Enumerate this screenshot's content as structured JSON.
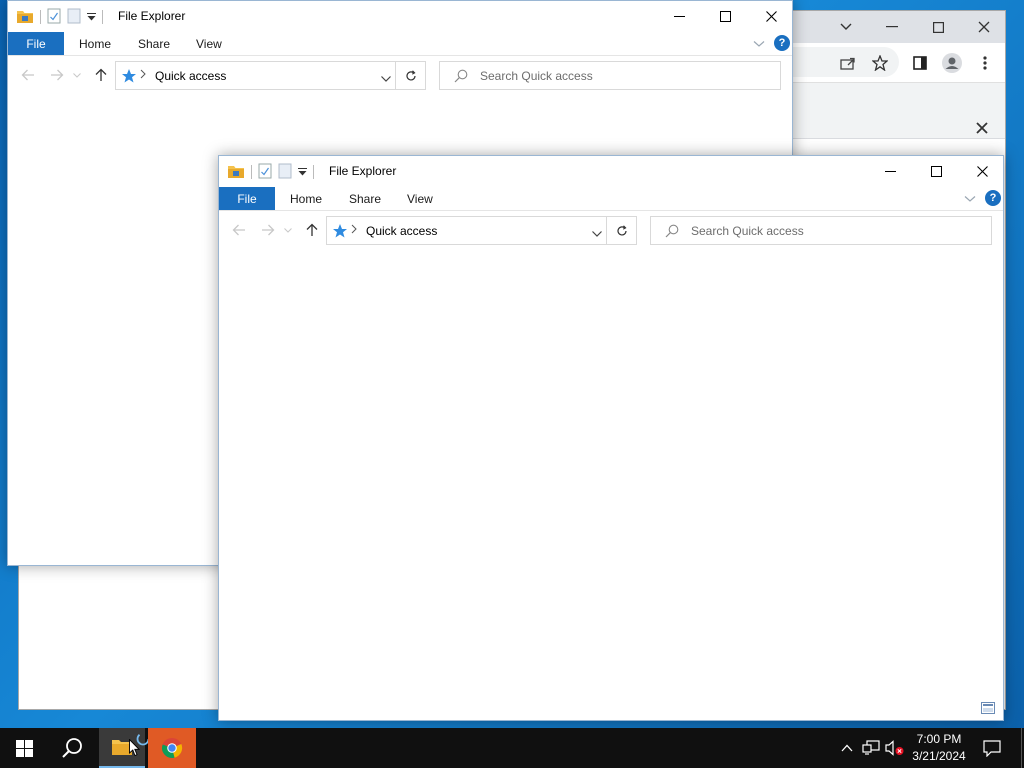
{
  "file_explorer_back": {
    "title": "File Explorer",
    "tabs": {
      "file": "File",
      "home": "Home",
      "share": "Share",
      "view": "View"
    },
    "address": "Quick access",
    "search_placeholder": "Search Quick access",
    "help": "?"
  },
  "file_explorer_front": {
    "title": "File Explorer",
    "tabs": {
      "file": "File",
      "home": "Home",
      "share": "Share",
      "view": "View"
    },
    "address": "Quick access",
    "search_placeholder": "Search Quick access",
    "help": "?"
  },
  "taskbar": {
    "time": "7:00 PM",
    "date": "3/21/2024"
  },
  "colors": {
    "accent": "#1a6fc0",
    "taskbar": "#101010",
    "desktop": "#1788d6"
  }
}
